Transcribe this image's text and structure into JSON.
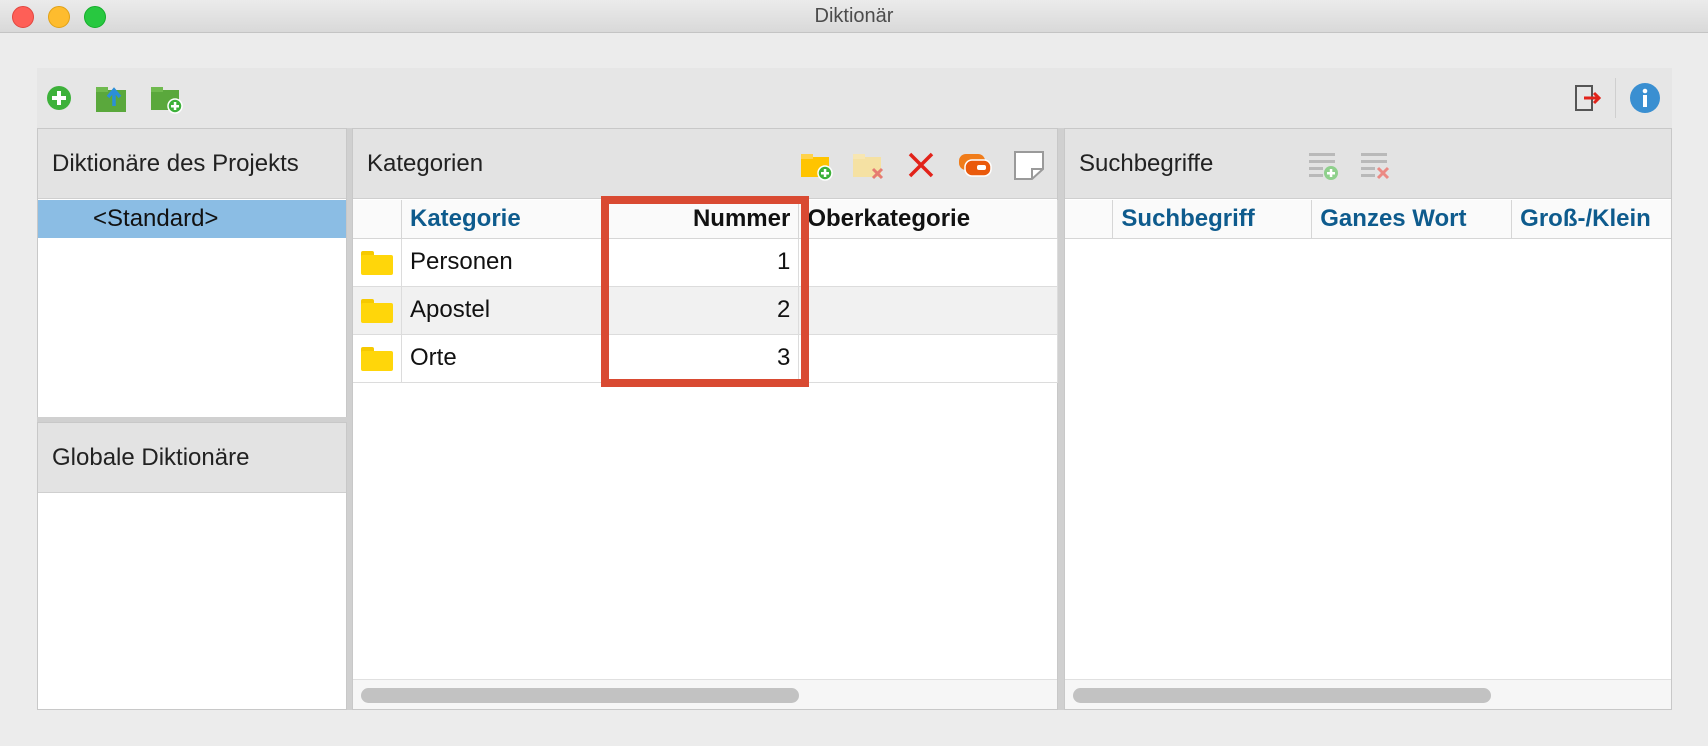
{
  "window": {
    "title": "Diktionär"
  },
  "colors": {
    "accent": "#0e5b8d",
    "selection": "#8bbde4",
    "highlight_box": "#d94a32",
    "folder": "#ffd60a"
  },
  "toolbar": {
    "left_icons": [
      "add-circle-icon",
      "export-folder-icon",
      "new-folder-icon"
    ],
    "right_icons": [
      "exit-icon",
      "info-icon"
    ]
  },
  "project_dictionaries": {
    "title": "Diktionäre des Projekts",
    "items": [
      "<Standard>"
    ]
  },
  "global_dictionaries": {
    "title": "Globale Diktionäre"
  },
  "categories": {
    "title": "Kategorien",
    "icons": [
      "new-category-icon",
      "delete-category-icon",
      "delete-icon",
      "code-icon",
      "memo-icon"
    ],
    "columns": {
      "category": "Kategorie",
      "number": "Nummer",
      "parent": "Oberkategorie"
    },
    "rows": [
      {
        "name": "Personen",
        "number": "1",
        "parent": ""
      },
      {
        "name": "Apostel",
        "number": "2",
        "parent": ""
      },
      {
        "name": "Orte",
        "number": "3",
        "parent": ""
      }
    ]
  },
  "search_terms": {
    "title": "Suchbegriffe",
    "icons": [
      "add-term-icon",
      "remove-term-icon"
    ],
    "columns": {
      "term": "Suchbegriff",
      "whole_word": "Ganzes Wort",
      "case": "Groß-/Klein"
    }
  }
}
